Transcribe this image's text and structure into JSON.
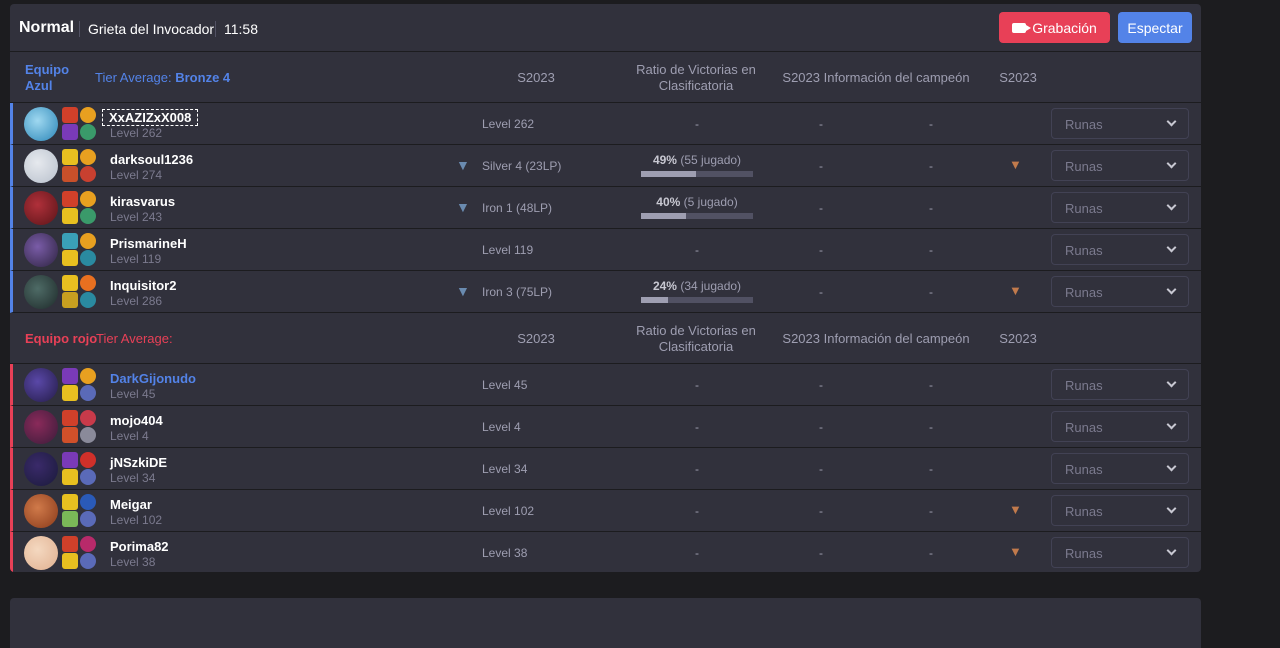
{
  "header": {
    "mode": "Normal",
    "map": "Grieta del Invocador",
    "time": "11:58",
    "record_label": "Grabación",
    "spectate_label": "Espectar"
  },
  "columns": {
    "season": "S2023",
    "winrate": "Ratio de Victorias en Clasificatoria",
    "champion_info": "S2023 Información del campeón",
    "season2": "S2023"
  },
  "blue_team": {
    "name": "Equipo Azul",
    "tier_label": "Tier Average:",
    "tier_value": "Bronze 4",
    "players": [
      {
        "name": "XxAZIZxX008",
        "level": "Level 262",
        "rank": "Level 262",
        "winrate": "-",
        "has_bar": false,
        "col4": "-",
        "col5": "-",
        "emblem": false,
        "runes": "Runas"
      },
      {
        "name": "darksoul1236",
        "level": "Level 274",
        "rank": "Silver 4 (23LP)",
        "wr_pct": "49%",
        "wr_games": "(55 jugado)",
        "wr_fill": 0.49,
        "has_bar": true,
        "col4": "-",
        "col5": "-",
        "emblem": true,
        "runes": "Runas"
      },
      {
        "name": "kirasvarus",
        "level": "Level 243",
        "rank": "Iron 1 (48LP)",
        "wr_pct": "40%",
        "wr_games": "(5 jugado)",
        "wr_fill": 0.4,
        "has_bar": true,
        "col4": "-",
        "col5": "-",
        "emblem": false,
        "runes": "Runas"
      },
      {
        "name": "PrismarineH",
        "level": "Level 119",
        "rank": "Level 119",
        "winrate": "-",
        "has_bar": false,
        "col4": "-",
        "col5": "-",
        "emblem": false,
        "runes": "Runas"
      },
      {
        "name": "Inquisitor2",
        "level": "Level 286",
        "rank": "Iron 3 (75LP)",
        "wr_pct": "24%",
        "wr_games": "(34 jugado)",
        "wr_fill": 0.24,
        "has_bar": true,
        "col4": "-",
        "col5": "-",
        "emblem": true,
        "runes": "Runas"
      }
    ]
  },
  "red_team": {
    "name": "Equipo rojo",
    "tier_label": "Tier Average:",
    "players": [
      {
        "name": "DarkGijonudo",
        "level": "Level 45",
        "rank": "Level 45",
        "winrate": "-",
        "col4": "-",
        "col5": "-",
        "emblem": false,
        "runes": "Runas"
      },
      {
        "name": "mojo404",
        "level": "Level 4",
        "rank": "Level 4",
        "winrate": "-",
        "col4": "-",
        "col5": "-",
        "emblem": false,
        "runes": "Runas"
      },
      {
        "name": "jNSzkiDE",
        "level": "Level 34",
        "rank": "Level 34",
        "winrate": "-",
        "col4": "-",
        "col5": "-",
        "emblem": false,
        "runes": "Runas"
      },
      {
        "name": "Meigar",
        "level": "Level 102",
        "rank": "Level 102",
        "winrate": "-",
        "col4": "-",
        "col5": "-",
        "emblem": true,
        "runes": "Runas"
      },
      {
        "name": "Porima82",
        "level": "Level 38",
        "rank": "Level 38",
        "winrate": "-",
        "col4": "-",
        "col5": "-",
        "emblem": true,
        "runes": "Runas"
      }
    ]
  },
  "colors": {
    "blue": "#5383e8",
    "red": "#e84057",
    "panel": "#31313c"
  }
}
